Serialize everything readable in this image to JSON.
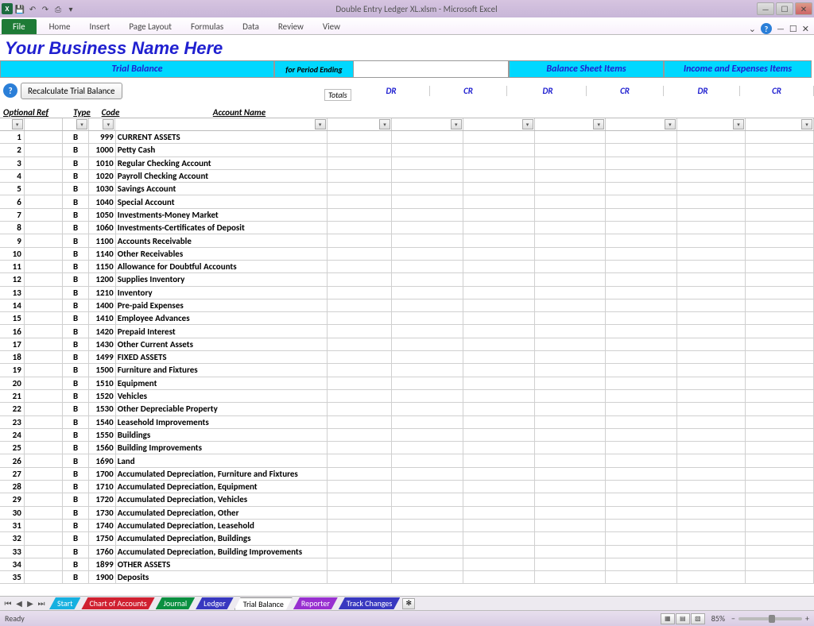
{
  "titlebar": {
    "text": "Double Entry Ledger XL.xlsm  -  Microsoft Excel"
  },
  "ribbon": {
    "file": "File",
    "tabs": [
      "Home",
      "Insert",
      "Page Layout",
      "Formulas",
      "Data",
      "Review",
      "View"
    ]
  },
  "business_name": "Your Business Name Here",
  "banner": {
    "trial_balance": "Trial Balance",
    "period": "for Period Ending",
    "balance_sheet": "Balance Sheet Items",
    "income": "Income and Expenses Items"
  },
  "controls": {
    "recalc_label": "Recalculate Trial Balance",
    "totals": "Totals"
  },
  "cols": {
    "optref": "Optional Ref",
    "type": "Type",
    "code": "Code",
    "acct": "Account Name",
    "dr": "DR",
    "cr": "CR"
  },
  "rows": [
    {
      "n": 1,
      "type": "B",
      "code": "999",
      "acct": "CURRENT ASSETS"
    },
    {
      "n": 2,
      "type": "B",
      "code": "1000",
      "acct": "Petty Cash"
    },
    {
      "n": 3,
      "type": "B",
      "code": "1010",
      "acct": "Regular Checking Account"
    },
    {
      "n": 4,
      "type": "B",
      "code": "1020",
      "acct": "Payroll Checking Account"
    },
    {
      "n": 5,
      "type": "B",
      "code": "1030",
      "acct": "Savings Account"
    },
    {
      "n": 6,
      "type": "B",
      "code": "1040",
      "acct": "Special Account"
    },
    {
      "n": 7,
      "type": "B",
      "code": "1050",
      "acct": "Investments-Money Market"
    },
    {
      "n": 8,
      "type": "B",
      "code": "1060",
      "acct": "Investments-Certificates of Deposit"
    },
    {
      "n": 9,
      "type": "B",
      "code": "1100",
      "acct": "Accounts Receivable"
    },
    {
      "n": 10,
      "type": "B",
      "code": "1140",
      "acct": "Other Receivables"
    },
    {
      "n": 11,
      "type": "B",
      "code": "1150",
      "acct": "Allowance for Doubtful Accounts"
    },
    {
      "n": 12,
      "type": "B",
      "code": "1200",
      "acct": "Supplies Inventory"
    },
    {
      "n": 13,
      "type": "B",
      "code": "1210",
      "acct": "Inventory"
    },
    {
      "n": 14,
      "type": "B",
      "code": "1400",
      "acct": "Pre-paid Expenses"
    },
    {
      "n": 15,
      "type": "B",
      "code": "1410",
      "acct": "Employee Advances"
    },
    {
      "n": 16,
      "type": "B",
      "code": "1420",
      "acct": "Prepaid Interest"
    },
    {
      "n": 17,
      "type": "B",
      "code": "1430",
      "acct": "Other Current Assets"
    },
    {
      "n": 18,
      "type": "B",
      "code": "1499",
      "acct": "FIXED ASSETS"
    },
    {
      "n": 19,
      "type": "B",
      "code": "1500",
      "acct": "Furniture and Fixtures"
    },
    {
      "n": 20,
      "type": "B",
      "code": "1510",
      "acct": "Equipment"
    },
    {
      "n": 21,
      "type": "B",
      "code": "1520",
      "acct": "Vehicles"
    },
    {
      "n": 22,
      "type": "B",
      "code": "1530",
      "acct": "Other Depreciable Property"
    },
    {
      "n": 23,
      "type": "B",
      "code": "1540",
      "acct": "Leasehold Improvements"
    },
    {
      "n": 24,
      "type": "B",
      "code": "1550",
      "acct": "Buildings"
    },
    {
      "n": 25,
      "type": "B",
      "code": "1560",
      "acct": "Building Improvements"
    },
    {
      "n": 26,
      "type": "B",
      "code": "1690",
      "acct": "Land"
    },
    {
      "n": 27,
      "type": "B",
      "code": "1700",
      "acct": "Accumulated Depreciation, Furniture and Fixtures"
    },
    {
      "n": 28,
      "type": "B",
      "code": "1710",
      "acct": "Accumulated Depreciation, Equipment"
    },
    {
      "n": 29,
      "type": "B",
      "code": "1720",
      "acct": "Accumulated Depreciation, Vehicles"
    },
    {
      "n": 30,
      "type": "B",
      "code": "1730",
      "acct": "Accumulated Depreciation, Other"
    },
    {
      "n": 31,
      "type": "B",
      "code": "1740",
      "acct": "Accumulated Depreciation, Leasehold"
    },
    {
      "n": 32,
      "type": "B",
      "code": "1750",
      "acct": "Accumulated Depreciation, Buildings"
    },
    {
      "n": 33,
      "type": "B",
      "code": "1760",
      "acct": "Accumulated Depreciation, Building Improvements"
    },
    {
      "n": 34,
      "type": "B",
      "code": "1899",
      "acct": "OTHER ASSETS"
    },
    {
      "n": 35,
      "type": "B",
      "code": "1900",
      "acct": "Deposits"
    }
  ],
  "sheettabs": {
    "start": "Start",
    "chart": "Chart of Accounts",
    "journal": "Journal",
    "ledger": "Ledger",
    "trial": "Trial Balance",
    "reporter": "Reporter",
    "track": "Track Changes"
  },
  "status": {
    "ready": "Ready",
    "zoom": "85%"
  }
}
